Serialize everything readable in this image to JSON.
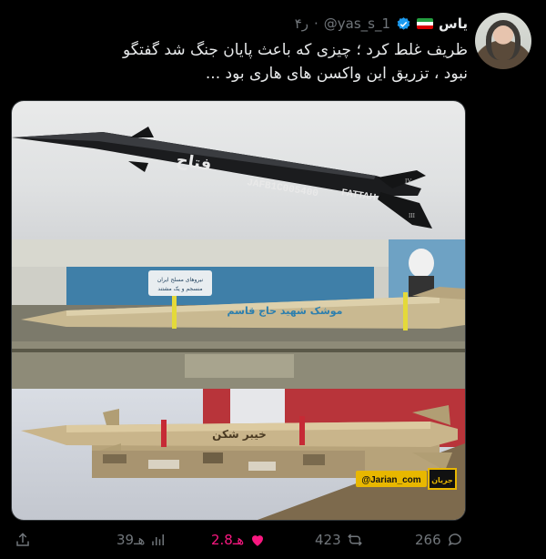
{
  "tweet": {
    "author_name": "یاس",
    "handle": "@yas_s_1",
    "time": "۴ر",
    "separator": "·",
    "text": "ظریف غلط کرد ؛ چیزی که باعث پایان جنگ شد گفتگو\nنبود ، تزریق این واکسن های هاری بود ...",
    "colors": {
      "like": "#f91880",
      "verified": "#1d9bf0",
      "muted": "#71767b"
    }
  },
  "media": {
    "panel1": {
      "missile_name_fa": "فتاح",
      "serial": "JAFB1C005400",
      "name_en": "FATTAH",
      "fin_mark": "IV",
      "fin_mark2": "III"
    },
    "panel2": {
      "banner_text_line1": "نیروهای مسلح ایران",
      "banner_text_line2": "منسجم و یک مشتند",
      "missile_text": "موشک شهید حاج قاسم"
    },
    "panel3": {
      "missile_text": "خیبر شکن",
      "watermark": "@Jarian_com",
      "watermark_logo": "جریان"
    }
  },
  "actions": {
    "views": "39هـ",
    "likes": "2.8هـ",
    "retweets": "423",
    "replies": "266"
  }
}
